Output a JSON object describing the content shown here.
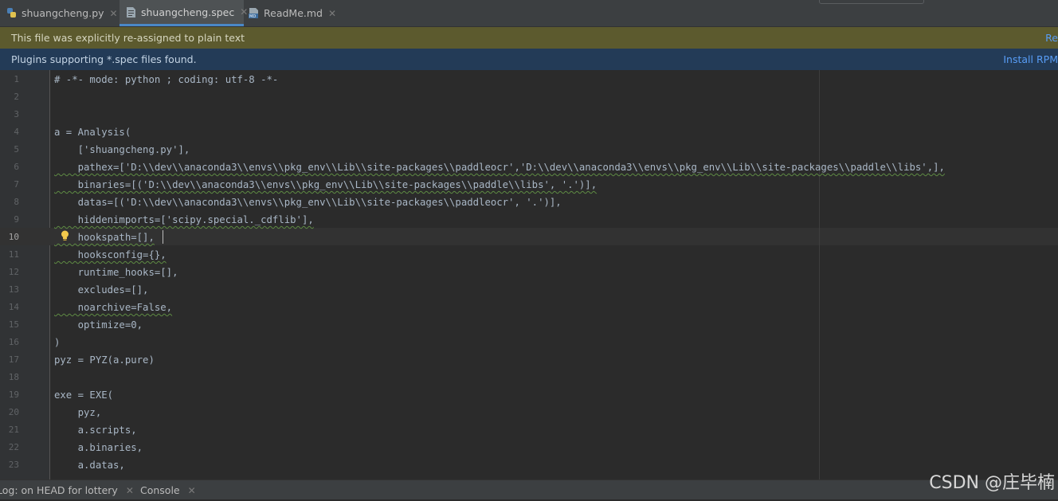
{
  "tabs": [
    {
      "label": "shuangcheng.py",
      "icon": "python-file-icon",
      "active": false
    },
    {
      "label": "shuangcheng.spec",
      "icon": "text-file-icon",
      "active": true
    },
    {
      "label": "ReadMe.md",
      "icon": "markdown-file-icon",
      "active": false
    }
  ],
  "banners": {
    "plain_text": {
      "message": "This file was explicitly re-assigned to plain text",
      "action": "Re"
    },
    "plugins": {
      "message": "Plugins supporting *.spec files found.",
      "action": "Install RPM"
    }
  },
  "editor": {
    "current_line": 10,
    "line_numbers": [
      "1",
      "2",
      "3",
      "4",
      "5",
      "6",
      "7",
      "8",
      "9",
      "10",
      "11",
      "12",
      "13",
      "14",
      "15",
      "16",
      "17",
      "18",
      "19",
      "20",
      "21",
      "22",
      "23"
    ],
    "lines": [
      "# -*- mode: python ; coding: utf-8 -*-",
      "",
      "",
      "a = Analysis(",
      "    ['shuangcheng.py'],",
      "    pathex=['D:\\\\dev\\\\anaconda3\\\\envs\\\\pkg_env\\\\Lib\\\\site-packages\\\\paddleocr','D:\\\\dev\\\\anaconda3\\\\envs\\\\pkg_env\\\\Lib\\\\site-packages\\\\paddle\\\\libs',],",
      "    binaries=[('D:\\\\dev\\\\anaconda3\\\\envs\\\\pkg_env\\\\Lib\\\\site-packages\\\\paddle\\\\libs', '.')],",
      "    datas=[('D:\\\\dev\\\\anaconda3\\\\envs\\\\pkg_env\\\\Lib\\\\site-packages\\\\paddleocr', '.')],",
      "    hiddenimports=['scipy.special._cdflib'],",
      "    hookspath=[],",
      "    hooksconfig={},",
      "    runtime_hooks=[],",
      "    excludes=[],",
      "    noarchive=False,",
      "    optimize=0,",
      ")",
      "pyz = PYZ(a.pure)",
      "",
      "exe = EXE(",
      "    pyz,",
      "    a.scripts,",
      "    a.binaries,",
      "    a.datas,"
    ]
  },
  "bottom_tabs": [
    {
      "label": "Log: on HEAD for lottery"
    },
    {
      "label": "Console"
    }
  ],
  "watermark": "CSDN @庄毕楠",
  "colors": {
    "accent": "#4a88c7",
    "banner_yellow": "#5c5a2e",
    "banner_blue": "#233b57",
    "link": "#589df6"
  }
}
